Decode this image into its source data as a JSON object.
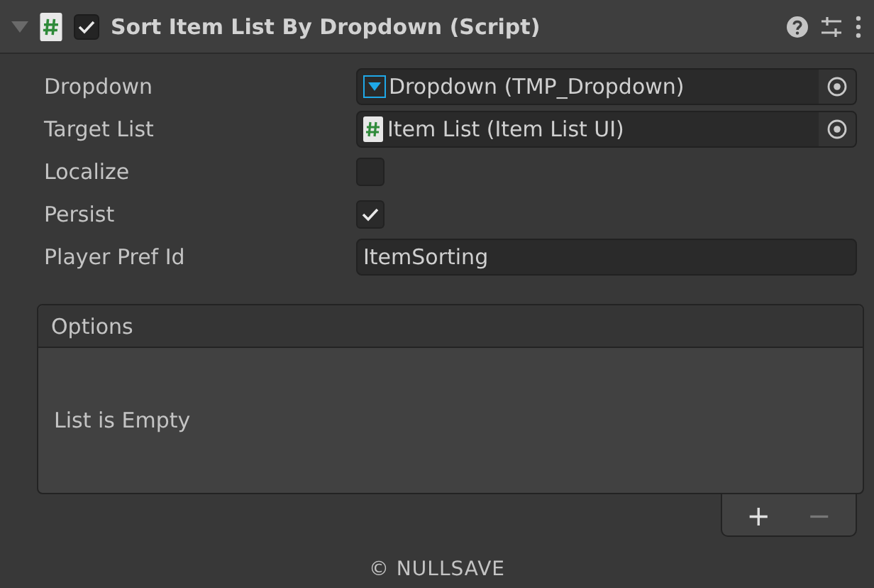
{
  "component": {
    "title": "Sort Item List By Dropdown (Script)",
    "expanded": true,
    "enabled": true
  },
  "fields": [
    {
      "kind": "object",
      "label": "Dropdown",
      "value": "Dropdown (TMP_Dropdown)"
    },
    {
      "kind": "object",
      "label": "Target List",
      "value": "Item List (Item List UI)"
    },
    {
      "kind": "checkbox",
      "label": "Localize",
      "checked": false
    },
    {
      "kind": "checkbox",
      "label": "Persist",
      "checked": true
    },
    {
      "kind": "text",
      "label": "Player Pref Id",
      "value": "ItemSorting"
    }
  ],
  "list": {
    "title": "Options",
    "empty_text": "List is Empty",
    "add": {
      "label": "+",
      "disabled": false
    },
    "remove": {
      "label": "−",
      "disabled": true
    }
  },
  "footer": "© NULLSAVE"
}
